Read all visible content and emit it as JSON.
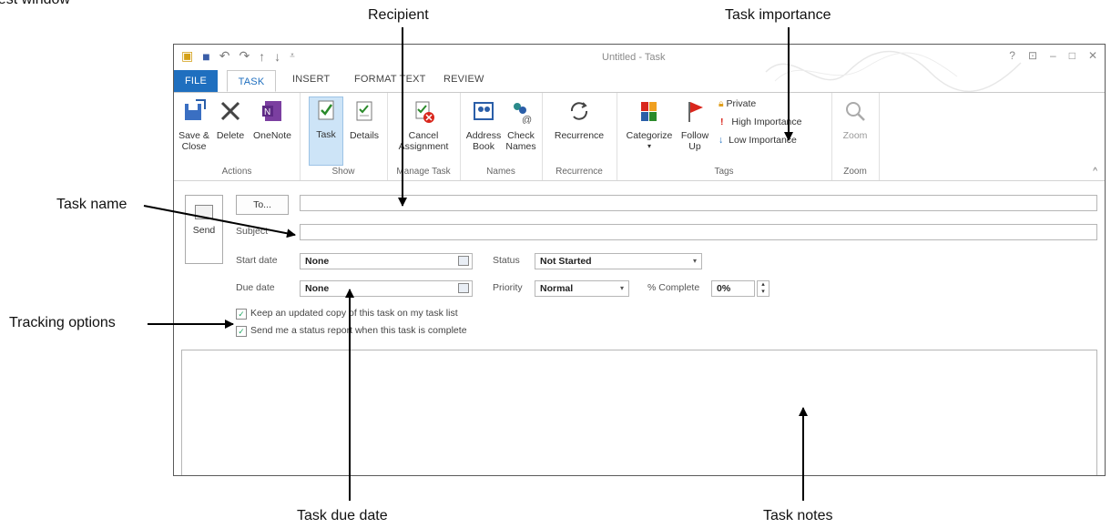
{
  "annotations": {
    "cropped_top_left": "quest window",
    "recipient": "Recipient",
    "task_importance": "Task importance",
    "task_name": "Task name",
    "tracking_options": "Tracking options",
    "task_due_date": "Task due date",
    "task_notes": "Task notes"
  },
  "window": {
    "title": "Untitled - Task",
    "controls": [
      "?",
      "⊡",
      "–",
      "□",
      "✕"
    ]
  },
  "tabs": [
    "FILE",
    "TASK",
    "INSERT",
    "FORMAT TEXT",
    "REVIEW"
  ],
  "ribbon": {
    "actions": {
      "label": "Actions",
      "save_close": "Save & Close",
      "delete": "Delete",
      "onenote": "OneNote"
    },
    "show": {
      "label": "Show",
      "task": "Task",
      "details": "Details"
    },
    "manage": {
      "label": "Manage Task",
      "cancel": "Cancel Assignment"
    },
    "names": {
      "label": "Names",
      "address_book": "Address Book",
      "check_names": "Check Names"
    },
    "recurrence": {
      "label": "Recurrence",
      "button": "Recurrence"
    },
    "tags": {
      "label": "Tags",
      "categorize": "Categorize",
      "follow_up": "Follow Up",
      "private": "Private",
      "high": "High Importance",
      "low": "Low Importance"
    },
    "zoom": {
      "label": "Zoom",
      "button": "Zoom"
    }
  },
  "form": {
    "send": "Send",
    "to": "To...",
    "subject_label": "Subject",
    "start_label": "Start date",
    "start_value": "None",
    "due_label": "Due date",
    "due_value": "None",
    "status_label": "Status",
    "status_value": "Not Started",
    "priority_label": "Priority",
    "priority_value": "Normal",
    "complete_label": "% Complete",
    "complete_value": "0%",
    "keep_copy": "Keep an updated copy of this task on my task list",
    "status_report": "Send me a status report when this task is complete"
  },
  "colors": {
    "accent": "#1f6fbf",
    "selected": "#cde4f7",
    "high_importance": "#d9261c",
    "low_importance": "#1f6fbf"
  }
}
